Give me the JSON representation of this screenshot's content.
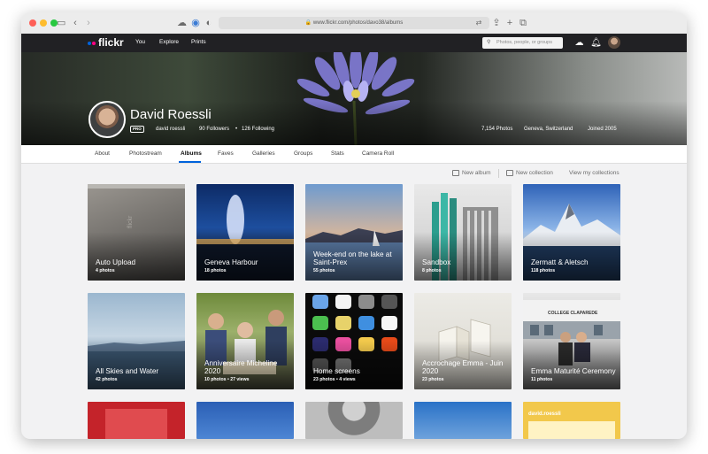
{
  "browser": {
    "url": "www.flickr.com/photos/davo38/albums"
  },
  "nav": {
    "logo": "flickr",
    "links": [
      "You",
      "Explore",
      "Prints"
    ],
    "search_placeholder": "Photos, people, or groups"
  },
  "profile": {
    "name": "David Roessli",
    "badge": "PRO",
    "username": "david roessli",
    "followers": "90 Followers",
    "following": "126 Following",
    "photos": "7,154 Photos",
    "location": "Geneva, Switzerland",
    "joined": "Joined 2005"
  },
  "tabs": [
    "About",
    "Photostream",
    "Albums",
    "Faves",
    "Galleries",
    "Groups",
    "Stats",
    "Camera Roll"
  ],
  "actions": {
    "new_album": "New album",
    "new_collection": "New collection",
    "view_collections": "View my collections"
  },
  "albums": [
    {
      "title": "Auto Upload",
      "meta": "4 photos"
    },
    {
      "title": "Geneva Harbour",
      "meta": "18 photos"
    },
    {
      "title": "Week-end on the lake at Saint-Prex",
      "meta": "55 photos"
    },
    {
      "title": "Sandbox",
      "meta": "8 photos"
    },
    {
      "title": "Zermatt & Aletsch",
      "meta": "118 photos"
    },
    {
      "title": "All Skies and Water",
      "meta": "42 photos"
    },
    {
      "title": "Anniversaire Micheline 2020",
      "meta": "10 photos  •  27 views"
    },
    {
      "title": "Home screens",
      "meta": "23 photos  •  4 views"
    },
    {
      "title": "Accrochage Emma - Juin 2020",
      "meta": "23 photos"
    },
    {
      "title": "Emma Maturité Ceremony",
      "meta": "11 photos"
    }
  ],
  "partial_tile_text": "david.roessli"
}
